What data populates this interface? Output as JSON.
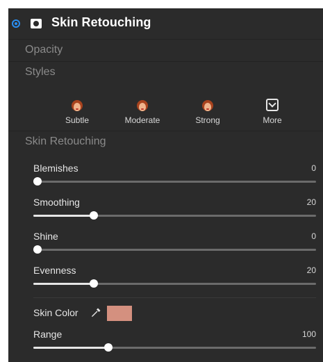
{
  "panel": {
    "title": "Skin Retouching",
    "sections": {
      "opacity": "Opacity",
      "styles": "Styles",
      "skin_retouching": "Skin Retouching"
    }
  },
  "styles": [
    {
      "label": "Subtle",
      "icon": "face-icon"
    },
    {
      "label": "Moderate",
      "icon": "face-icon"
    },
    {
      "label": "Strong",
      "icon": "face-icon"
    },
    {
      "label": "More",
      "icon": "more-icon"
    }
  ],
  "sliders": [
    {
      "label": "Blemishes",
      "value": "0",
      "level": 0
    },
    {
      "label": "Smoothing",
      "value": "20",
      "level": 0.2
    },
    {
      "label": "Shine",
      "value": "0",
      "level": 0
    },
    {
      "label": "Evenness",
      "value": "20",
      "level": 0.2
    }
  ],
  "skin_color": {
    "label": "Skin Color",
    "swatch_color": "#d4907f",
    "icon": "eyedropper-icon"
  },
  "range": {
    "label": "Range",
    "value": "100",
    "level": 0.25
  },
  "colors": {
    "accent": "#2a8df0",
    "panel_bg": "#2b2b2b"
  }
}
